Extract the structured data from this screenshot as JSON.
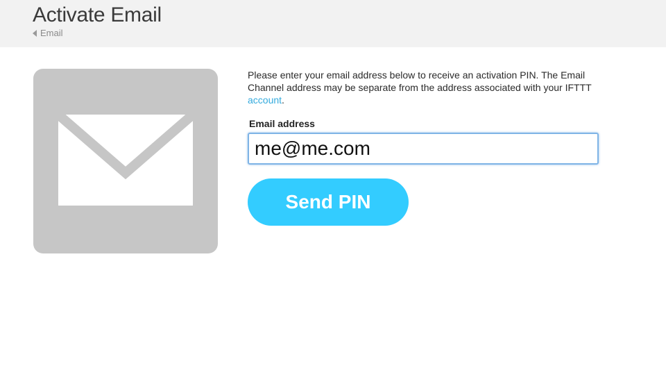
{
  "header": {
    "title": "Activate Email",
    "breadcrumb_label": "Email",
    "breadcrumb_icon": "back-caret-icon"
  },
  "channel": {
    "icon": "envelope-icon",
    "icon_bg_color": "#c6c6c6"
  },
  "form": {
    "description_before_link": "Please enter your email address below to receive an activation PIN. The Email Channel address may be separate from the address associated with your IFTTT ",
    "account_link": "account",
    "description_after_link": ".",
    "email_label": "Email address",
    "email_value": "me@me.com",
    "send_button_label": "Send PIN",
    "accent_color": "#33ccff",
    "link_color": "#33aadd"
  }
}
